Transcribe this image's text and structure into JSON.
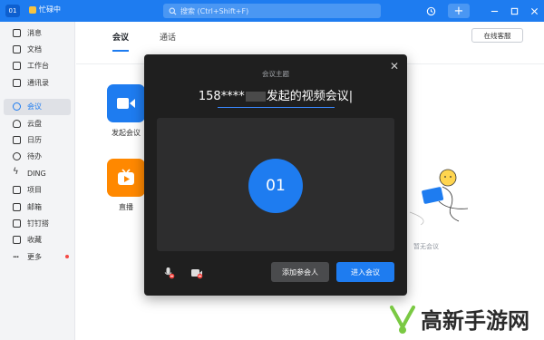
{
  "titlebar": {
    "avatar_text": "01",
    "status_text": "忙碌中",
    "search_placeholder": "搜索 (Ctrl+Shift+F)",
    "bg_color": "#1e7cf0"
  },
  "sidebar": {
    "items": [
      {
        "label": "消息",
        "icon": "message-icon"
      },
      {
        "label": "文档",
        "icon": "document-icon"
      },
      {
        "label": "工作台",
        "icon": "workbench-icon"
      },
      {
        "label": "通讯录",
        "icon": "contacts-icon"
      },
      {
        "label": "会议",
        "icon": "phone-icon",
        "active": true
      },
      {
        "label": "云盘",
        "icon": "cloud-icon"
      },
      {
        "label": "日历",
        "icon": "calendar-icon"
      },
      {
        "label": "待办",
        "icon": "todo-icon"
      },
      {
        "label": "DING",
        "icon": "ding-icon"
      },
      {
        "label": "项目",
        "icon": "project-icon"
      },
      {
        "label": "邮箱",
        "icon": "mail-icon"
      },
      {
        "label": "钉钉搭",
        "icon": "builder-icon"
      },
      {
        "label": "收藏",
        "icon": "favorite-icon"
      },
      {
        "label": "更多",
        "icon": "more-icon",
        "badge": true
      }
    ]
  },
  "main": {
    "tabs": [
      {
        "label": "会议",
        "active": true
      },
      {
        "label": "通话",
        "active": false
      }
    ],
    "service_button": "在线客服",
    "apps": [
      {
        "label": "发起会议",
        "color": "#1e7cf0",
        "icon": "video-camera-icon"
      },
      {
        "label": "直播",
        "color": "#ff8800",
        "icon": "tv-icon"
      }
    ],
    "empty_text": "暂无会议"
  },
  "dialog": {
    "subtitle": "会议主题",
    "title_prefix": "158****",
    "title_suffix": "发起的视频会议",
    "avatar_text": "01",
    "invite_button": "添加参会人",
    "join_button": "进入会议"
  },
  "watermark": {
    "text": "高新手游网"
  }
}
